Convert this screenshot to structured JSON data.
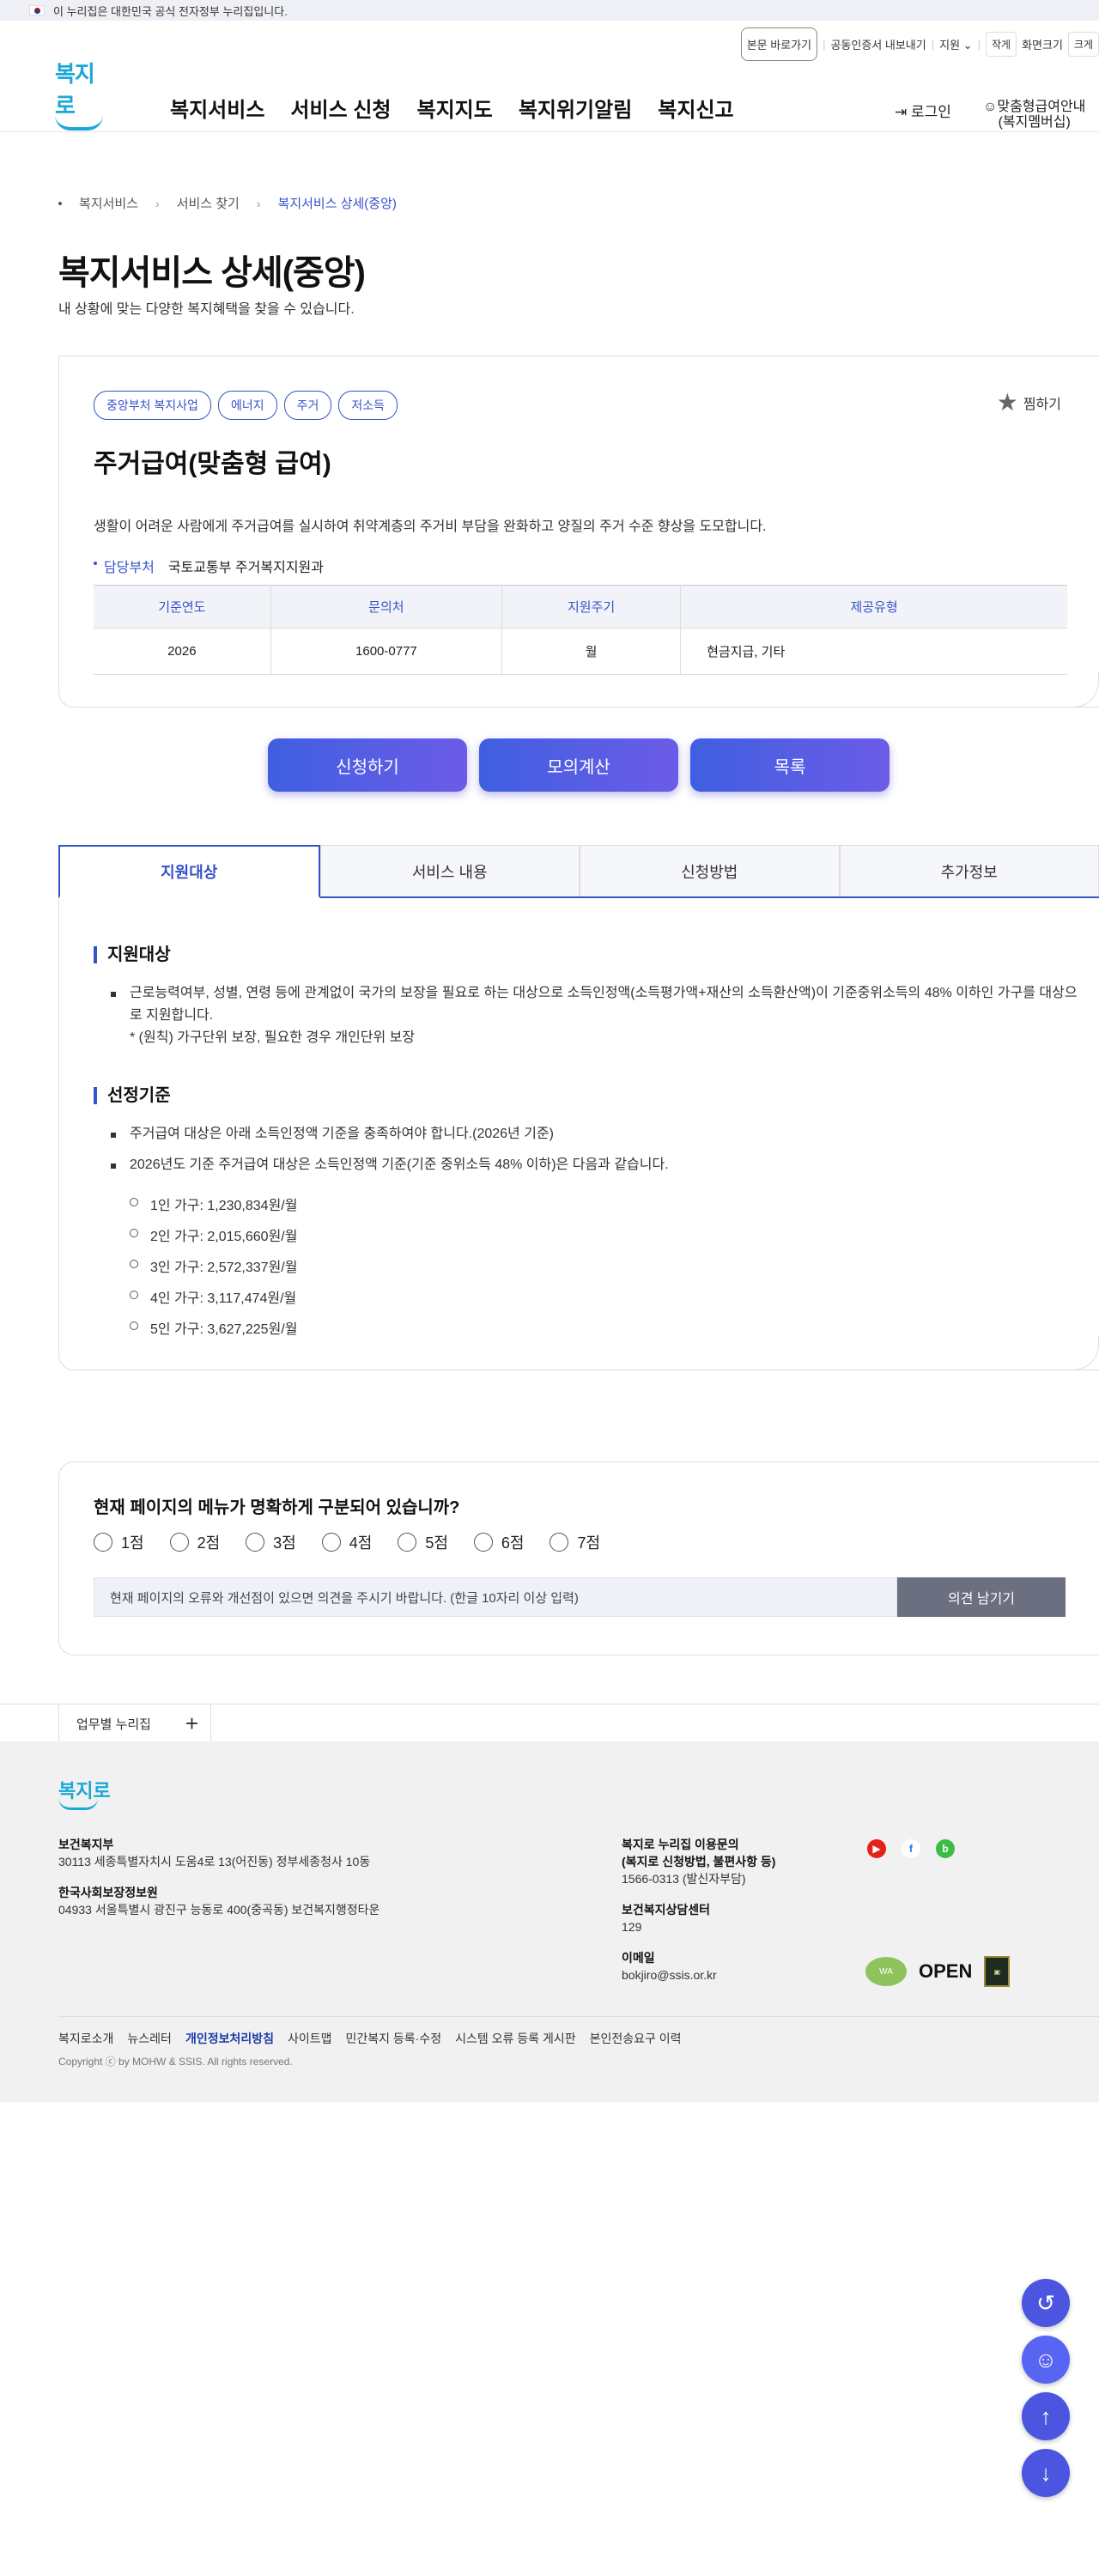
{
  "gov_banner": "이 누리집은 대한민국 공식 전자정부 누리집입니다.",
  "util": {
    "skip": "본문 바로가기",
    "cert": "공동인증서 내보내기",
    "lang": "지원",
    "small": "작게",
    "screen": "화면크기",
    "large": "크게"
  },
  "logo_text": "복지로",
  "gnb": [
    "복지서비스",
    "서비스 신청",
    "복지지도",
    "복지위기알림",
    "복지신고"
  ],
  "login": "로그인",
  "custom_line1": "맞춤형급여안내",
  "custom_line2": "(복지멤버십)",
  "breadcrumb": [
    "복지서비스",
    "서비스 찾기",
    "복지서비스 상세(중앙)"
  ],
  "page_title": "복지서비스 상세(중앙)",
  "page_sub": "내 상황에 맞는 다양한 복지혜택을 찾을 수 있습니다.",
  "detail": {
    "tags": [
      "중앙부처 복지사업",
      "에너지",
      "주거",
      "저소득"
    ],
    "fav": "찜하기",
    "title": "주거급여(맞춤형 급여)",
    "desc": "생활이 어려운 사람에게 주거급여를 실시하여 취약계층의 주거비 부담을 완화하고 양질의 주거 수준 향상을 도모합니다.",
    "dept_key": "담당부처",
    "dept_val": "국토교통부 주거복지지원과",
    "table_headers": [
      "기준연도",
      "문의처",
      "지원주기",
      "제공유형"
    ],
    "table_row": [
      "2026",
      "1600-0777",
      "월",
      "현금지급, 기타"
    ]
  },
  "actions": [
    "신청하기",
    "모의계산",
    "목록"
  ],
  "tabs": [
    "지원대상",
    "서비스 내용",
    "신청방법",
    "추가정보"
  ],
  "content": {
    "h1": "지원대상",
    "b1_line1": "근로능력여부, 성별, 연령 등에 관계없이 국가의 보장을 필요로 하는 대상으로 소득인정액(소득평가액+재산의 소득환산액)이 기준중위소득의 48% 이하인 가구를 대상으",
    "b1_line2": "로 지원합니다.",
    "b1_note": "* (원칙) 가구단위 보장, 필요한 경우 개인단위 보장",
    "h2": "선정기준",
    "b2": "주거급여 대상은 아래 소득인정액 기준을 충족하여야 합니다.(2026년 기준)",
    "b3": "2026년도 기준 주거급여 대상은 소득인정액 기준(기준 중위소득 48% 이하)은 다음과 같습니다.",
    "circles": [
      "1인 가구: 1,230,834원/월",
      "2인 가구: 2,015,660원/월",
      "3인 가구: 2,572,337원/월",
      "4인 가구: 3,117,474원/월",
      "5인 가구: 3,627,225원/월"
    ]
  },
  "survey": {
    "question": "현재 페이지의 메뉴가 명확하게 구분되어 있습니까?",
    "options": [
      "1점",
      "2점",
      "3점",
      "4점",
      "5점",
      "6점",
      "7점"
    ],
    "placeholder": "현재 페이지의 오류와 개선점이 있으면 의견을 주시기 바랍니다. (한글 10자리 이상 입력)",
    "button": "의견 남기기"
  },
  "portal": "업무별 누리집",
  "footer": {
    "logo": "복지로",
    "org1_name": "보건복지부",
    "org1_addr": "30113 세종특별자치시 도움4로 13(어진동) 정부세종청사 10동",
    "org2_name": "한국사회보장정보원",
    "org2_addr": "04933 서울특별시 광진구 능동로 400(중곡동) 보건복지행정타운",
    "contact1_title": "복지로 누리집 이용문의",
    "contact1_sub": "(복지로 신청방법, 불편사항 등)",
    "contact1_tel": "1566-0313 (발신자부담)",
    "contact2_title": "보건복지상담센터",
    "contact2_tel": "129",
    "email_title": "이메일",
    "email": "bokjiro@ssis.or.kr",
    "links": [
      "복지로소개",
      "뉴스레터",
      "개인정보처리방침",
      "사이트맵",
      "민간복지 등록·수정",
      "시스템 오류 등록 게시판",
      "본인전송요구 이력"
    ],
    "copyright": "Copyright ⓒ by MOHW & SSIS. All rights reserved.",
    "badge_open": "OPEN"
  },
  "icons": [
    "flag-icon",
    "chevron-down-icon",
    "login-icon",
    "user-icon",
    "star-icon",
    "plus-icon",
    "youtube-icon",
    "facebook-icon",
    "blog-icon",
    "history-icon",
    "chatbot-icon",
    "arrow-up-icon",
    "arrow-down-icon"
  ],
  "colors": {
    "accent": "#3553c8",
    "button_gradient_start": "#3f5fe0",
    "button_gradient_end": "#6c5ce7",
    "logo": "#1ba8d8",
    "float": "#4b55e0"
  }
}
